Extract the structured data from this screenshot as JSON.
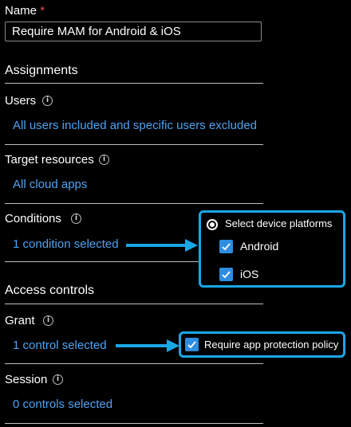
{
  "name": {
    "label": "Name",
    "required_marker": "*",
    "value": "Require MAM for Android & iOS"
  },
  "assignments": {
    "heading": "Assignments"
  },
  "users": {
    "label": "Users",
    "value": "All users included and specific users excluded"
  },
  "target_resources": {
    "label": "Target resources",
    "value": "All cloud apps"
  },
  "conditions": {
    "label": "Conditions",
    "value": "1 condition selected",
    "callout": {
      "title": "Select device platforms",
      "options": [
        "Android",
        "iOS"
      ]
    }
  },
  "access_controls": {
    "heading": "Access controls"
  },
  "grant": {
    "label": "Grant",
    "value": "1 control selected",
    "callout": {
      "option": "Require app protection policy"
    }
  },
  "session": {
    "label": "Session",
    "value": "0 controls selected"
  },
  "colors": {
    "link": "#4ea3f2",
    "accent": "#19a7e6",
    "checkbox": "#2e8de0",
    "required": "#e05050"
  },
  "icons": [
    "info-icon",
    "checkmark-icon",
    "radio-icon",
    "arrow-right-icon"
  ]
}
